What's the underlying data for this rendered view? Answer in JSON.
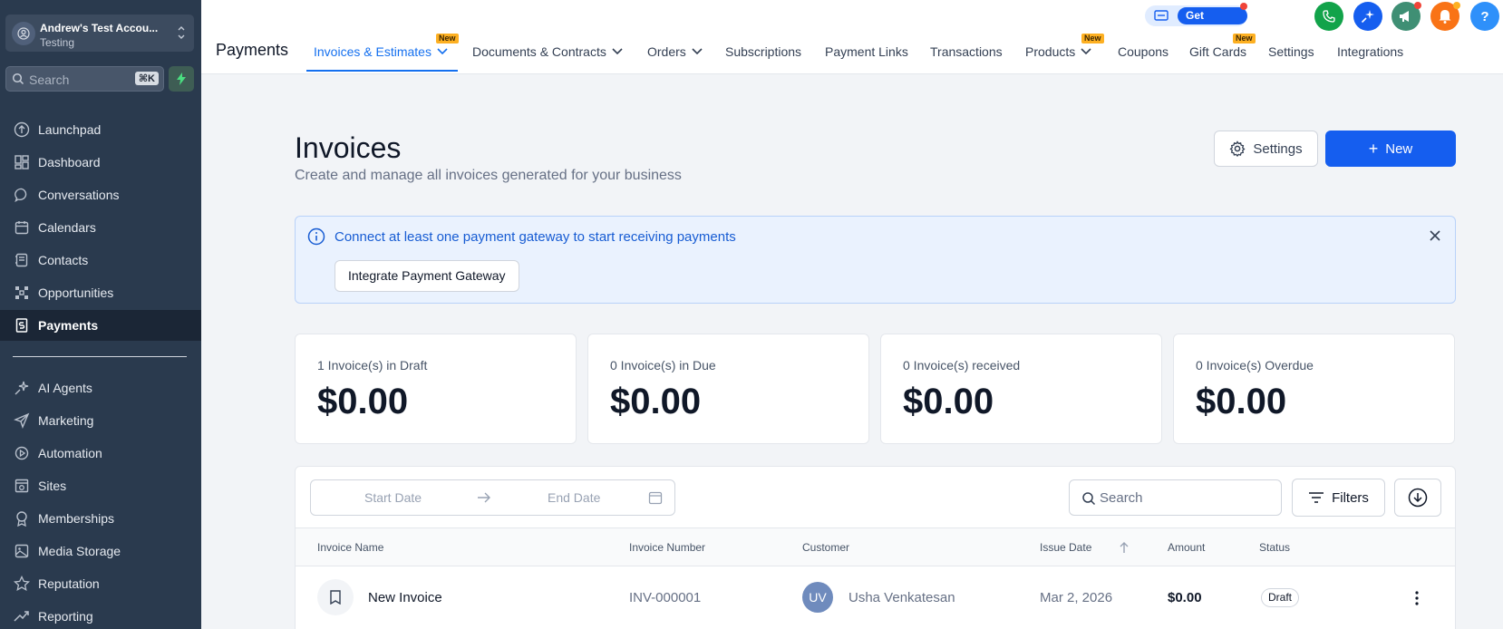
{
  "sidebar": {
    "account_name": "Andrew's Test Accou...",
    "account_sub": "Testing",
    "search_placeholder": "Search",
    "search_shortcut": "⌘K",
    "items": [
      {
        "label": "Launchpad",
        "icon": "rocket-icon"
      },
      {
        "label": "Dashboard",
        "icon": "grid-icon"
      },
      {
        "label": "Conversations",
        "icon": "chat-icon"
      },
      {
        "label": "Calendars",
        "icon": "calendar-icon"
      },
      {
        "label": "Contacts",
        "icon": "contacts-icon"
      },
      {
        "label": "Opportunities",
        "icon": "opportunities-icon"
      },
      {
        "label": "Payments",
        "icon": "payments-icon"
      }
    ],
    "items2": [
      {
        "label": "AI Agents",
        "icon": "sparkle-icon"
      },
      {
        "label": "Marketing",
        "icon": "send-icon"
      },
      {
        "label": "Automation",
        "icon": "automation-icon"
      },
      {
        "label": "Sites",
        "icon": "sites-icon"
      },
      {
        "label": "Memberships",
        "icon": "membership-icon"
      },
      {
        "label": "Media Storage",
        "icon": "image-icon"
      },
      {
        "label": "Reputation",
        "icon": "star-icon"
      },
      {
        "label": "Reporting",
        "icon": "trend-icon"
      }
    ],
    "active_item": "Payments"
  },
  "topbar": {
    "title": "Payments",
    "tabs": [
      {
        "label": "Invoices & Estimates",
        "badge": "New",
        "dropdown": true
      },
      {
        "label": "Documents & Contracts",
        "dropdown": true
      },
      {
        "label": "Orders",
        "dropdown": true
      },
      {
        "label": "Subscriptions"
      },
      {
        "label": "Payment Links"
      },
      {
        "label": "Transactions"
      },
      {
        "label": "Products",
        "badge": "New",
        "dropdown": true
      },
      {
        "label": "Coupons"
      },
      {
        "label": "Gift Cards",
        "badge": "New"
      },
      {
        "label": "Settings"
      },
      {
        "label": "Integrations"
      }
    ],
    "get_started": "Get Started",
    "help": "?"
  },
  "page": {
    "title": "Invoices",
    "subtitle": "Create and manage all invoices generated for your business",
    "settings_button": "Settings",
    "new_button": "New"
  },
  "alert": {
    "message": "Connect at least one payment gateway to start receiving payments",
    "button": "Integrate Payment Gateway"
  },
  "stats": [
    {
      "label": "1 Invoice(s) in Draft",
      "value": "$0.00"
    },
    {
      "label": "0 Invoice(s) in Due",
      "value": "$0.00"
    },
    {
      "label": "0 Invoice(s) received",
      "value": "$0.00"
    },
    {
      "label": "0 Invoice(s) Overdue",
      "value": "$0.00"
    }
  ],
  "table": {
    "start_date_placeholder": "Start Date",
    "end_date_placeholder": "End Date",
    "search_placeholder": "Search",
    "filters_button": "Filters",
    "columns": [
      "Invoice Name",
      "Invoice Number",
      "Customer",
      "Issue Date",
      "Amount",
      "Status"
    ],
    "rows": [
      {
        "name": "New Invoice",
        "number": "INV-000001",
        "customer_initials": "UV",
        "customer": "Usha Venkatesan",
        "issue_date": "Mar 2, 2026",
        "amount": "$0.00",
        "status": "Draft"
      }
    ]
  },
  "colors": {
    "sidebar_bg": "#2a3a4e",
    "accent": "#155eef",
    "alert_bg": "#eaf2fe"
  }
}
